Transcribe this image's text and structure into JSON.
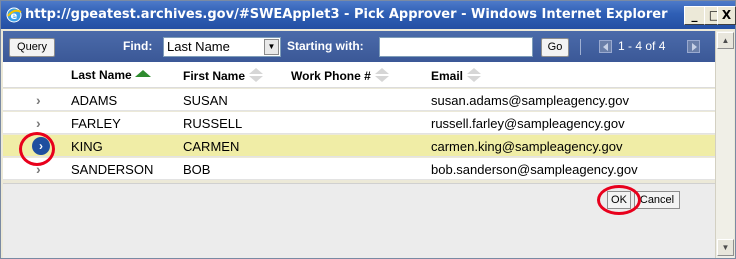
{
  "window": {
    "title": "http://gpeatest.archives.gov/#SWEApplet3 - Pick Approver - Windows Internet Explorer",
    "controls": {
      "minimize": "_",
      "maximize": "□",
      "close": "X"
    }
  },
  "toolbar": {
    "query_label": "Query",
    "find_label": "Find:",
    "find_value": "Last Name",
    "starting_with_label": "Starting with:",
    "starting_with_value": "",
    "go_label": "Go",
    "page_info": "1 - 4 of 4"
  },
  "grid": {
    "columns": [
      "Last Name",
      "First Name",
      "Work Phone #",
      "Email"
    ],
    "rows": [
      {
        "last": "ADAMS",
        "first": "SUSAN",
        "phone": "",
        "email": "susan.adams@sampleagency.gov"
      },
      {
        "last": "FARLEY",
        "first": "RUSSELL",
        "phone": "",
        "email": "russell.farley@sampleagency.gov"
      },
      {
        "last": "KING",
        "first": "CARMEN",
        "phone": "",
        "email": "carmen.king@sampleagency.gov"
      },
      {
        "last": "SANDERSON",
        "first": "BOB",
        "phone": "",
        "email": "bob.sanderson@sampleagency.gov"
      }
    ],
    "selected_index": 2,
    "row_marker": "›"
  },
  "footer": {
    "ok_label": "OK",
    "cancel_label": "Cancel"
  },
  "colors": {
    "title_bar": "#2f5fb5",
    "toolbar": "#445f9f",
    "selected_row": "#f0eda6",
    "highlight_ring": "#e8001c",
    "sort_active": "#2e8b2e"
  }
}
